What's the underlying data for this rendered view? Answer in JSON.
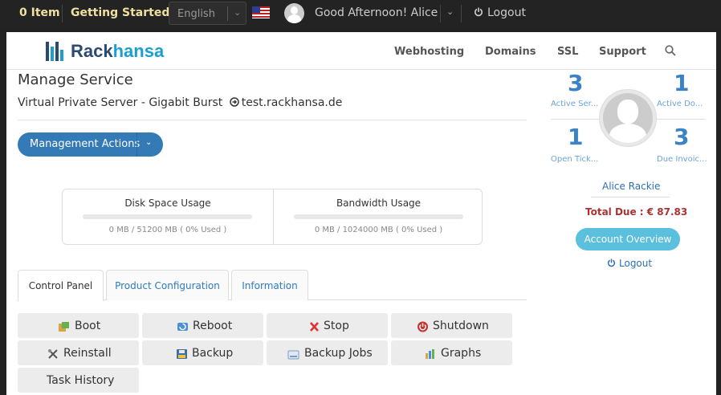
{
  "topbar": {
    "cart": "0 Item",
    "getting_started": "Getting Started",
    "language": "English",
    "greeting": "Good Afternoon! Alice",
    "logout": "Logout"
  },
  "header": {
    "logo_part1": "Rack",
    "logo_part2": "hansa",
    "nav": [
      "Webhosting",
      "Domains",
      "SSL",
      "Support"
    ]
  },
  "main": {
    "title": "Manage Service",
    "product": "Virtual Private Server - Gigabit Burst",
    "domain": "test.rackhansa.de",
    "management_actions": "Management Actions",
    "disk": {
      "label": "Disk Space Usage",
      "value": "0 MB / 51200 MB ( 0% Used )",
      "percent": 0
    },
    "bandwidth": {
      "label": "Bandwidth Usage",
      "value": "0 MB / 1024000 MB ( 0% Used )",
      "percent": 0
    },
    "tabs": [
      "Control Panel",
      "Product Configuration",
      "Information"
    ],
    "actions": [
      "Boot",
      "Reboot",
      "Stop",
      "Shutdown",
      "Reinstall",
      "Backup",
      "Backup Jobs",
      "Graphs",
      "Task History"
    ]
  },
  "sidebar": {
    "stats": [
      {
        "value": "3",
        "label": "Active Ser..."
      },
      {
        "value": "1",
        "label": "Active Do..."
      },
      {
        "value": "1",
        "label": "Open Tick..."
      },
      {
        "value": "3",
        "label": "Due Invoic..."
      }
    ],
    "name": "Alice Rackie",
    "total_due": "Total Due : € 87.83",
    "account_overview": "Account Overview",
    "logout": "Logout"
  },
  "colors": {
    "primary": "#337ab7",
    "accent": "#5bc0de",
    "topbar": "#232323",
    "due": "#aa3333"
  }
}
